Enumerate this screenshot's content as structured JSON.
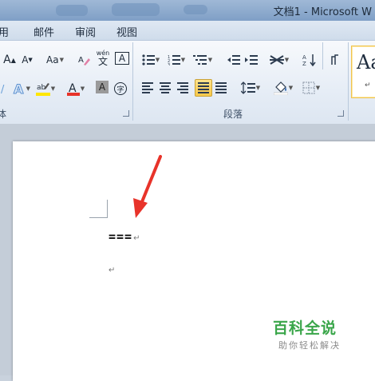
{
  "window": {
    "title": "文档1 - Microsoft W"
  },
  "tabs": [
    {
      "label": "用"
    },
    {
      "label": "邮件"
    },
    {
      "label": "审阅"
    },
    {
      "label": "视图"
    }
  ],
  "ribbon": {
    "font_group_label": "体",
    "paragraph_group_label": "段落",
    "font_buttons": {
      "grow": "A",
      "shrink": "A",
      "change_case": "Aa",
      "phonetic": "wén",
      "text_border": "A",
      "font_color": "A",
      "char_shading": "A",
      "enclose": "字"
    },
    "styles": {
      "preview": "Aa",
      "mark": "↵"
    }
  },
  "document": {
    "line1_text": "===",
    "paragraph_mark": "↵"
  },
  "watermark": {
    "title": "百科全说",
    "subtitle": "助你轻松解决"
  },
  "colors": {
    "accent_red": "#e8332a",
    "highlight_yellow": "#ffe600",
    "watermark_green": "#3aa64a"
  }
}
